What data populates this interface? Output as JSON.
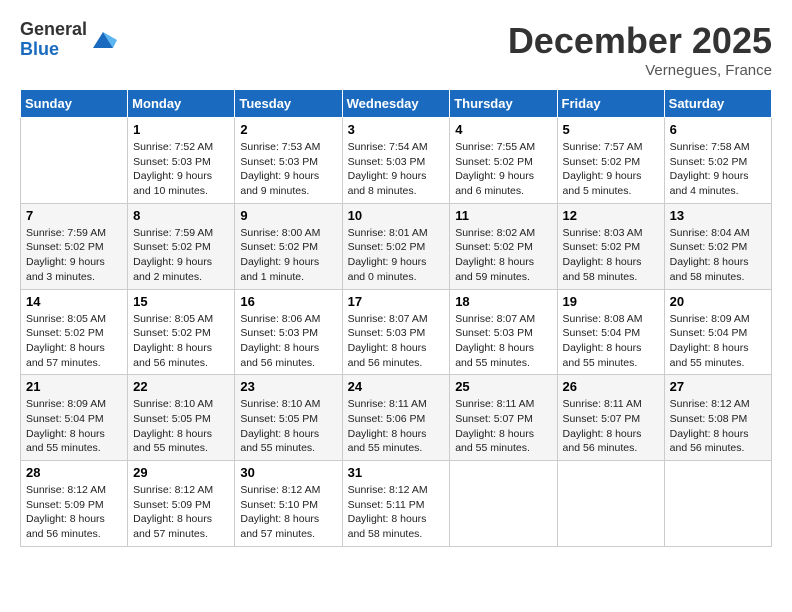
{
  "header": {
    "logo_general": "General",
    "logo_blue": "Blue",
    "month_title": "December 2025",
    "location": "Vernegues, France"
  },
  "columns": [
    "Sunday",
    "Monday",
    "Tuesday",
    "Wednesday",
    "Thursday",
    "Friday",
    "Saturday"
  ],
  "weeks": [
    [
      {
        "num": "",
        "data": ""
      },
      {
        "num": "1",
        "data": "Sunrise: 7:52 AM\nSunset: 5:03 PM\nDaylight: 9 hours\nand 10 minutes."
      },
      {
        "num": "2",
        "data": "Sunrise: 7:53 AM\nSunset: 5:03 PM\nDaylight: 9 hours\nand 9 minutes."
      },
      {
        "num": "3",
        "data": "Sunrise: 7:54 AM\nSunset: 5:03 PM\nDaylight: 9 hours\nand 8 minutes."
      },
      {
        "num": "4",
        "data": "Sunrise: 7:55 AM\nSunset: 5:02 PM\nDaylight: 9 hours\nand 6 minutes."
      },
      {
        "num": "5",
        "data": "Sunrise: 7:57 AM\nSunset: 5:02 PM\nDaylight: 9 hours\nand 5 minutes."
      },
      {
        "num": "6",
        "data": "Sunrise: 7:58 AM\nSunset: 5:02 PM\nDaylight: 9 hours\nand 4 minutes."
      }
    ],
    [
      {
        "num": "7",
        "data": "Sunrise: 7:59 AM\nSunset: 5:02 PM\nDaylight: 9 hours\nand 3 minutes."
      },
      {
        "num": "8",
        "data": "Sunrise: 7:59 AM\nSunset: 5:02 PM\nDaylight: 9 hours\nand 2 minutes."
      },
      {
        "num": "9",
        "data": "Sunrise: 8:00 AM\nSunset: 5:02 PM\nDaylight: 9 hours\nand 1 minute."
      },
      {
        "num": "10",
        "data": "Sunrise: 8:01 AM\nSunset: 5:02 PM\nDaylight: 9 hours\nand 0 minutes."
      },
      {
        "num": "11",
        "data": "Sunrise: 8:02 AM\nSunset: 5:02 PM\nDaylight: 8 hours\nand 59 minutes."
      },
      {
        "num": "12",
        "data": "Sunrise: 8:03 AM\nSunset: 5:02 PM\nDaylight: 8 hours\nand 58 minutes."
      },
      {
        "num": "13",
        "data": "Sunrise: 8:04 AM\nSunset: 5:02 PM\nDaylight: 8 hours\nand 58 minutes."
      }
    ],
    [
      {
        "num": "14",
        "data": "Sunrise: 8:05 AM\nSunset: 5:02 PM\nDaylight: 8 hours\nand 57 minutes."
      },
      {
        "num": "15",
        "data": "Sunrise: 8:05 AM\nSunset: 5:02 PM\nDaylight: 8 hours\nand 56 minutes."
      },
      {
        "num": "16",
        "data": "Sunrise: 8:06 AM\nSunset: 5:03 PM\nDaylight: 8 hours\nand 56 minutes."
      },
      {
        "num": "17",
        "data": "Sunrise: 8:07 AM\nSunset: 5:03 PM\nDaylight: 8 hours\nand 56 minutes."
      },
      {
        "num": "18",
        "data": "Sunrise: 8:07 AM\nSunset: 5:03 PM\nDaylight: 8 hours\nand 55 minutes."
      },
      {
        "num": "19",
        "data": "Sunrise: 8:08 AM\nSunset: 5:04 PM\nDaylight: 8 hours\nand 55 minutes."
      },
      {
        "num": "20",
        "data": "Sunrise: 8:09 AM\nSunset: 5:04 PM\nDaylight: 8 hours\nand 55 minutes."
      }
    ],
    [
      {
        "num": "21",
        "data": "Sunrise: 8:09 AM\nSunset: 5:04 PM\nDaylight: 8 hours\nand 55 minutes."
      },
      {
        "num": "22",
        "data": "Sunrise: 8:10 AM\nSunset: 5:05 PM\nDaylight: 8 hours\nand 55 minutes."
      },
      {
        "num": "23",
        "data": "Sunrise: 8:10 AM\nSunset: 5:05 PM\nDaylight: 8 hours\nand 55 minutes."
      },
      {
        "num": "24",
        "data": "Sunrise: 8:11 AM\nSunset: 5:06 PM\nDaylight: 8 hours\nand 55 minutes."
      },
      {
        "num": "25",
        "data": "Sunrise: 8:11 AM\nSunset: 5:07 PM\nDaylight: 8 hours\nand 55 minutes."
      },
      {
        "num": "26",
        "data": "Sunrise: 8:11 AM\nSunset: 5:07 PM\nDaylight: 8 hours\nand 56 minutes."
      },
      {
        "num": "27",
        "data": "Sunrise: 8:12 AM\nSunset: 5:08 PM\nDaylight: 8 hours\nand 56 minutes."
      }
    ],
    [
      {
        "num": "28",
        "data": "Sunrise: 8:12 AM\nSunset: 5:09 PM\nDaylight: 8 hours\nand 56 minutes."
      },
      {
        "num": "29",
        "data": "Sunrise: 8:12 AM\nSunset: 5:09 PM\nDaylight: 8 hours\nand 57 minutes."
      },
      {
        "num": "30",
        "data": "Sunrise: 8:12 AM\nSunset: 5:10 PM\nDaylight: 8 hours\nand 57 minutes."
      },
      {
        "num": "31",
        "data": "Sunrise: 8:12 AM\nSunset: 5:11 PM\nDaylight: 8 hours\nand 58 minutes."
      },
      {
        "num": "",
        "data": ""
      },
      {
        "num": "",
        "data": ""
      },
      {
        "num": "",
        "data": ""
      }
    ]
  ]
}
